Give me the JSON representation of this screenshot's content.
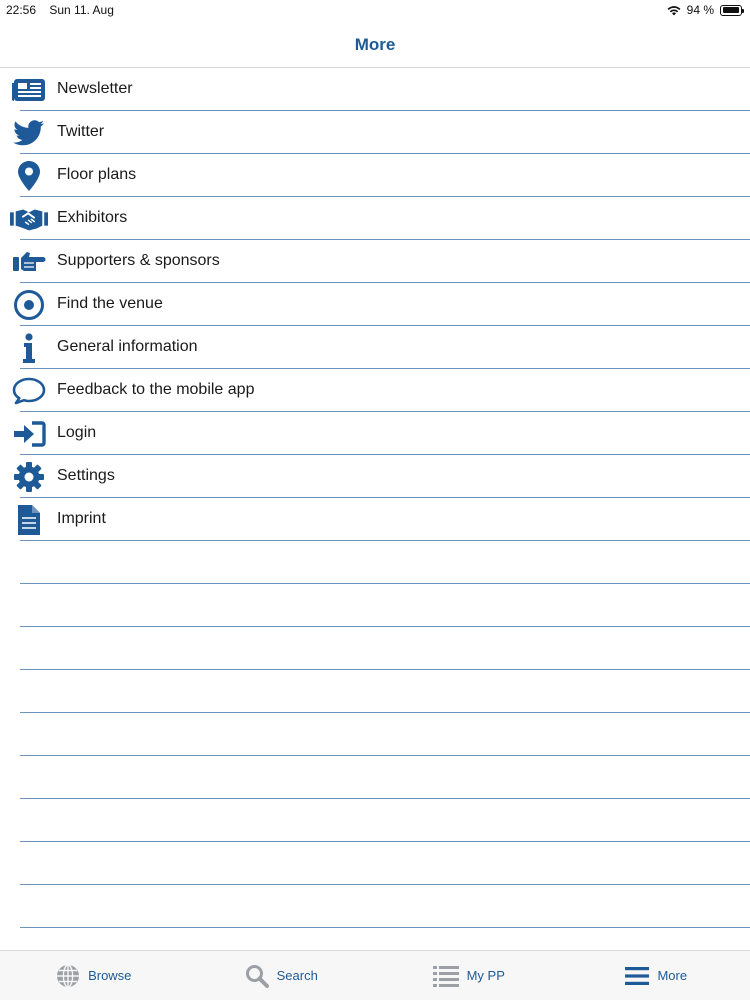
{
  "status_bar": {
    "time": "22:56",
    "date": "Sun 11. Aug",
    "battery": "94 %"
  },
  "nav": {
    "title": "More"
  },
  "menu": [
    {
      "label": "Newsletter",
      "icon": "newspaper-icon"
    },
    {
      "label": "Twitter",
      "icon": "twitter-bird-icon"
    },
    {
      "label": "Floor plans",
      "icon": "map-pin-icon"
    },
    {
      "label": "Exhibitors",
      "icon": "handshake-icon"
    },
    {
      "label": "Supporters & sponsors",
      "icon": "pointing-hand-icon"
    },
    {
      "label": "Find the venue",
      "icon": "target-icon"
    },
    {
      "label": "General information",
      "icon": "info-icon"
    },
    {
      "label": "Feedback to the mobile app",
      "icon": "speech-bubble-icon"
    },
    {
      "label": "Login",
      "icon": "sign-in-icon"
    },
    {
      "label": "Settings",
      "icon": "gear-icon"
    },
    {
      "label": "Imprint",
      "icon": "document-icon"
    }
  ],
  "tabs": [
    {
      "label": "Browse",
      "icon": "globe-icon"
    },
    {
      "label": "Search",
      "icon": "search-icon"
    },
    {
      "label": "My PP",
      "icon": "list-icon"
    },
    {
      "label": "More",
      "icon": "menu-icon"
    }
  ],
  "colors": {
    "accent": "#1d5a97",
    "separator": "#6f93bf"
  }
}
